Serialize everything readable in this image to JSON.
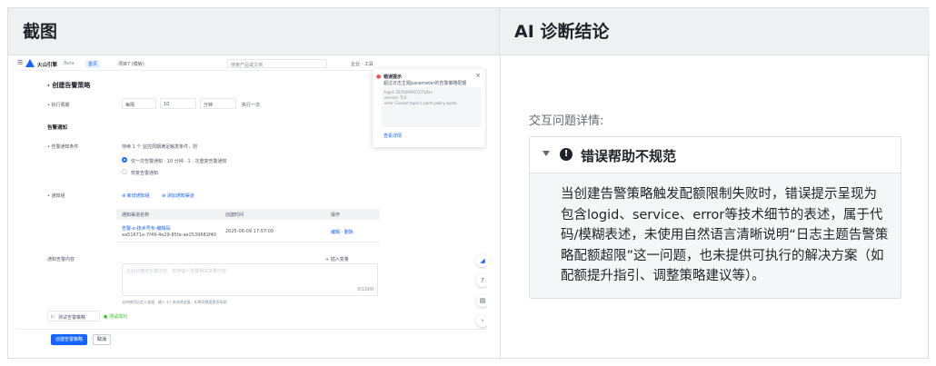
{
  "table": {
    "col_screenshot": "截图",
    "col_diagnosis": "AI 诊断结论"
  },
  "screenshot": {
    "brand": "火山引擎",
    "brand_badge": "Beta",
    "nav_home": "首页",
    "nav_project": "项目7 (模板)",
    "search_placeholder": "搜索产品或文档",
    "top_right": "企业 · 工具",
    "page_title": "创建告警策略",
    "row_period_label": "• 执行周期",
    "row_period_value": "每隔",
    "row_period_num": "10",
    "row_period_unit": "分钟",
    "row_period_exec": "执行一次",
    "section_notify": "告警通知",
    "row_trigger_label": "• 告警通知条件",
    "row_trigger_value": "持续  1  个  监控周期满足触发条件，则",
    "radio_once": "仅一次告警通知 · 10 分钟 · 1 · 次重复告警通知",
    "radio_recover": "恢复告警通知",
    "row_channel_label": "• 通知组",
    "link_add_group": "新增通知组",
    "link_add_rule": "添加通知渠道",
    "th_name": "通知渠道名称",
    "th_time": "创建时间",
    "th_op": "操作",
    "td_name": "告警-e-技术号专-编辑码",
    "td_id": "ea51671e-7f49-4e29-85fe-ae2539682f40",
    "td_time": "2025-06-09 17:57:09",
    "td_ops": "编辑 · 删除",
    "row_content_label": "通知告警内容",
    "insert_var": "插入变量",
    "content_placeholder": "在此处描述告警内容，支持输入告警相关变量内容",
    "counter": "0/1000",
    "hint": "支持使用自定义变量，输入 ${ 来选择变量，如果您需要更多帮助",
    "test_btn": "测试告警策略",
    "test_status": "测试成功",
    "popup_title": "错误提示",
    "popup_msg": "超过日志主题parameter的告警策略配额",
    "popup_code_1": "logid: 20250609175710xx",
    "popup_code_2": "service: TLS",
    "popup_code_3": "error: Exceed topic's alarm policy quota",
    "popup_link": "查看详情",
    "submit_btn": "创建告警策略",
    "cancel_btn": "取消"
  },
  "diagnosis": {
    "context_label": "交互问题详情:",
    "issue_title": "错误帮助不规范",
    "issue_text": "当创建告警策略触发配额限制失败时，错误提示呈现为包含logid、service、error等技术细节的表述，属于代码/模糊表述，未使用自然语言清晰说明“日志主题告警策略配额超限”这一问题，也未提供可执行的解决方案（如配额提升指引、调整策略建议等）。"
  },
  "colors": {
    "accent": "#1664ff",
    "error": "#f54a45",
    "success": "#34c724",
    "header_bg": "#eff0f1",
    "card_body_bg": "#f5f6f7"
  }
}
